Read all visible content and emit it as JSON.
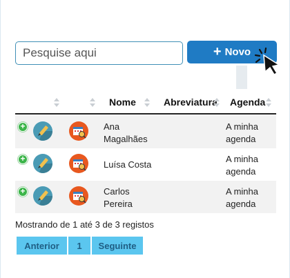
{
  "search": {
    "placeholder": "Pesquise aqui",
    "value": ""
  },
  "toolbar": {
    "new_label": "Novo",
    "new_icon": "plus-icon"
  },
  "table": {
    "headers": [
      "",
      "",
      "Nome",
      "Abreviatura",
      "Agenda"
    ],
    "rows": [
      {
        "nome_line1": "Ana",
        "nome_line2": "Magalhães",
        "abreviatura": "",
        "agenda_line1": "A minha",
        "agenda_line2": "agenda"
      },
      {
        "nome_line1": "Luísa Costa",
        "nome_line2": "",
        "abreviatura": "",
        "agenda_line1": "A minha",
        "agenda_line2": "agenda"
      },
      {
        "nome_line1": "Carlos",
        "nome_line2": "Pereira",
        "abreviatura": "",
        "agenda_line1": "A minha",
        "agenda_line2": "agenda"
      }
    ]
  },
  "footer": {
    "info": "Mostrando de 1 até 3 de 3 registos"
  },
  "pagination": {
    "prev": "Anterior",
    "page": "1",
    "next": "Seguinte"
  },
  "colors": {
    "primary": "#1f7bc4",
    "pager": "#5bc6ef",
    "expand": "#3cb54a",
    "calendar": "#e8581f",
    "edit": "#4a9bb5"
  }
}
